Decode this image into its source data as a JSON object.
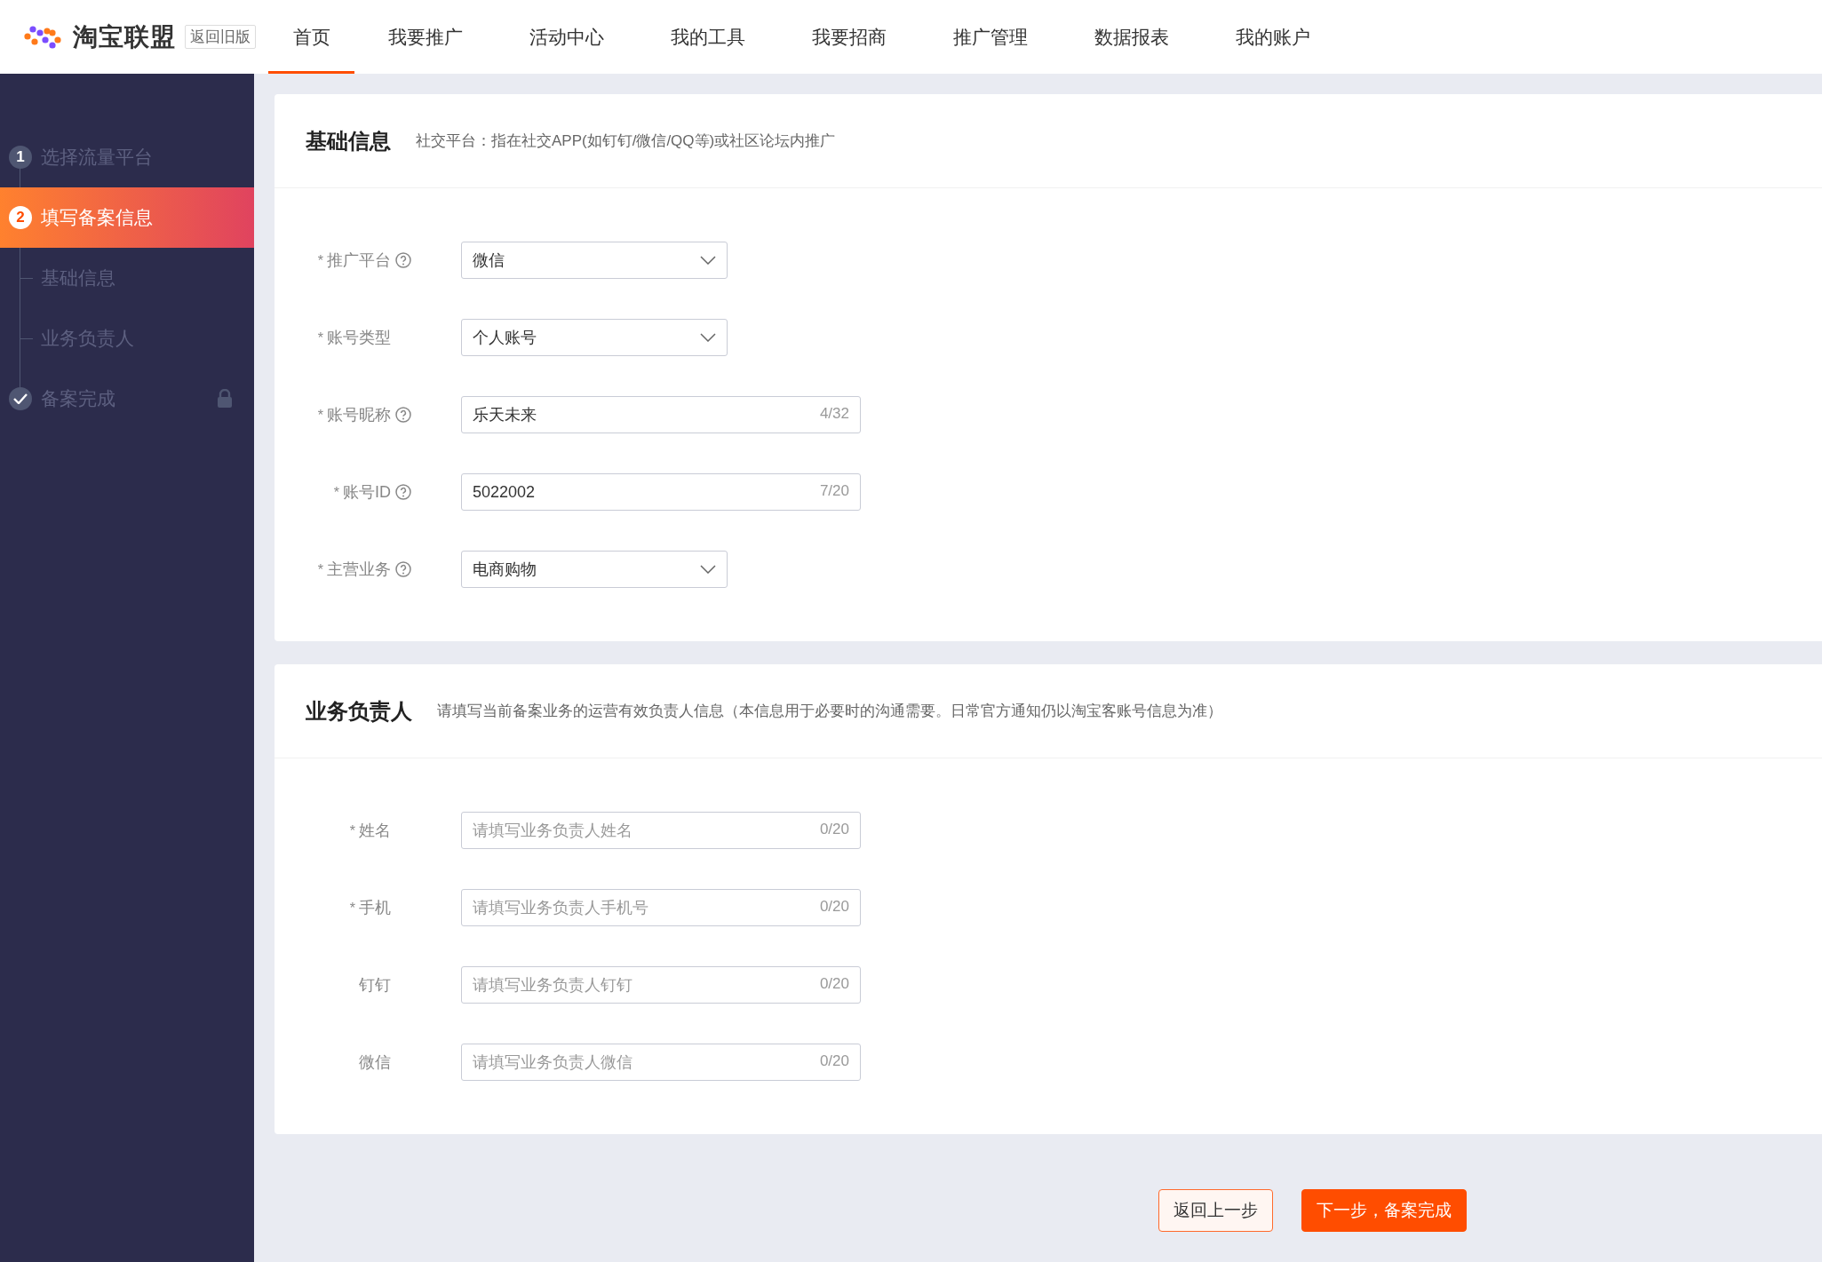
{
  "header": {
    "logo_text": "淘宝联盟",
    "old_version_link": "返回旧版",
    "nav": [
      {
        "label": "首页",
        "selected": true
      },
      {
        "label": "我要推广",
        "selected": false
      },
      {
        "label": "活动中心",
        "selected": false
      },
      {
        "label": "我的工具",
        "selected": false
      },
      {
        "label": "我要招商",
        "selected": false
      },
      {
        "label": "推广管理",
        "selected": false
      },
      {
        "label": "数据报表",
        "selected": false
      },
      {
        "label": "我的账户",
        "selected": false
      }
    ]
  },
  "sidebar": {
    "steps": [
      {
        "kind": "number",
        "marker": "1",
        "label": "选择流量平台",
        "selected": false
      },
      {
        "kind": "number",
        "marker": "2",
        "label": "填写备案信息",
        "selected": true,
        "children": [
          {
            "label": "基础信息"
          },
          {
            "label": "业务负责人"
          }
        ]
      },
      {
        "kind": "check",
        "label": "备案完成",
        "selected": false,
        "locked": true
      }
    ]
  },
  "sections": [
    {
      "title": "基础信息",
      "note": "社交平台：指在社交APP(如钉钉/微信/QQ等)或社区论坛内推广",
      "fields": [
        {
          "kind": "select",
          "required_mark": "*",
          "label": "推广平台",
          "help": true,
          "value": "微信"
        },
        {
          "kind": "select",
          "required_mark": "*",
          "label": "账号类型",
          "value": "个人账号"
        },
        {
          "kind": "input",
          "required_mark": "*",
          "label": "账号昵称",
          "help": true,
          "value": "乐天未来",
          "counter": "4/32"
        },
        {
          "kind": "input",
          "required_mark": "*",
          "label": "账号ID",
          "help": true,
          "value": "5022002",
          "counter": "7/20"
        },
        {
          "kind": "select",
          "required_mark": "*",
          "label": "主营业务",
          "help": true,
          "value": "电商购物"
        }
      ]
    },
    {
      "title": "业务负责人",
      "note": "请填写当前备案业务的运营有效负责人信息（本信息用于必要时的沟通需要。日常官方通知仍以淘宝客账号信息为准）",
      "fields": [
        {
          "kind": "input",
          "required_mark": "*",
          "label": "姓名",
          "placeholder": "请填写业务负责人姓名",
          "counter": "0/20"
        },
        {
          "kind": "input",
          "required_mark": "*",
          "label": "手机",
          "placeholder": "请填写业务负责人手机号",
          "counter": "0/20"
        },
        {
          "kind": "input",
          "label": "钉钉",
          "placeholder": "请填写业务负责人钉钉",
          "counter": "0/20"
        },
        {
          "kind": "input",
          "label": "微信",
          "placeholder": "请填写业务负责人微信",
          "counter": "0/20"
        }
      ]
    }
  ],
  "buttons": [
    {
      "kind": "secondary",
      "label": "返回上一步"
    },
    {
      "kind": "primary",
      "label": "下一步，备案完成"
    }
  ]
}
